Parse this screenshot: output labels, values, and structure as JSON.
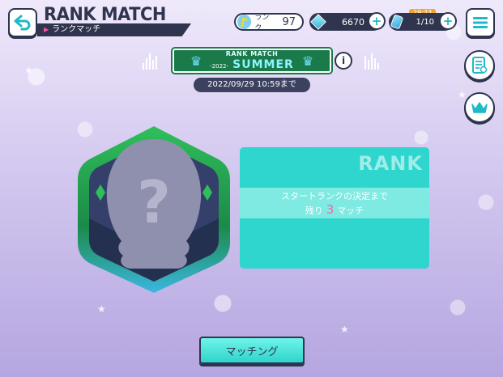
{
  "header": {
    "title": "RANK MATCH",
    "subtitle": "ランクマッチ"
  },
  "status_bar": {
    "rank_label": "ランク",
    "rank_value": "97",
    "crystals": "6670",
    "energy_timer": "29:33",
    "energy": "1/10"
  },
  "event": {
    "banner_line1": "RANK MATCH",
    "banner_line2": "SUMMER",
    "banner_year": "-2022-",
    "deadline": "2022/09/29 10:59まで"
  },
  "rank_panel": {
    "heading": "RANK",
    "line1": "スタートランクの決定まで",
    "line2_prefix": "残り",
    "remaining": "3",
    "line2_suffix": "マッチ"
  },
  "actions": {
    "match_button": "マッチング",
    "info_label": "i"
  },
  "colors": {
    "accent": "#2ed6ce",
    "dark": "#2f344f",
    "banner": "#1a7a4a",
    "highlight": "#ff5faf"
  }
}
